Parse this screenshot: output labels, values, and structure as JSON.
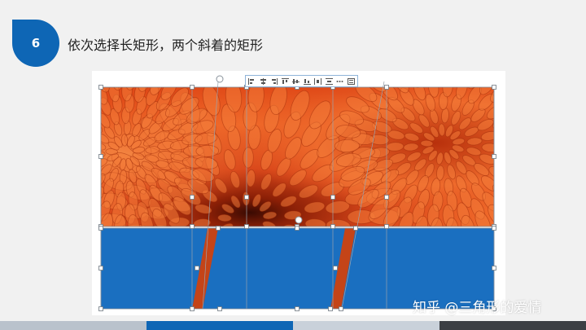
{
  "step": {
    "number": "6"
  },
  "heading": {
    "text": "依次选择长矩形，两个斜着的矩形"
  },
  "watermark": {
    "text": "知乎 @三角形的爱情"
  },
  "toolbar": {
    "icons": [
      "align-left-icon",
      "align-center-icon",
      "align-right-icon",
      "align-top-icon",
      "align-middle-icon",
      "align-bottom-icon",
      "distribute-horizontal-icon",
      "distribute-vertical-icon",
      "more-icon",
      "selection-pane-icon"
    ]
  },
  "colors": {
    "accent_blue": "#0e66b5",
    "rect_blue": "#1a6fc0",
    "flower_orange": "#e0521c",
    "bar_segments": [
      "#b9c2cc",
      "#0e66b5",
      "#c9d1da",
      "#3c3f44"
    ]
  }
}
